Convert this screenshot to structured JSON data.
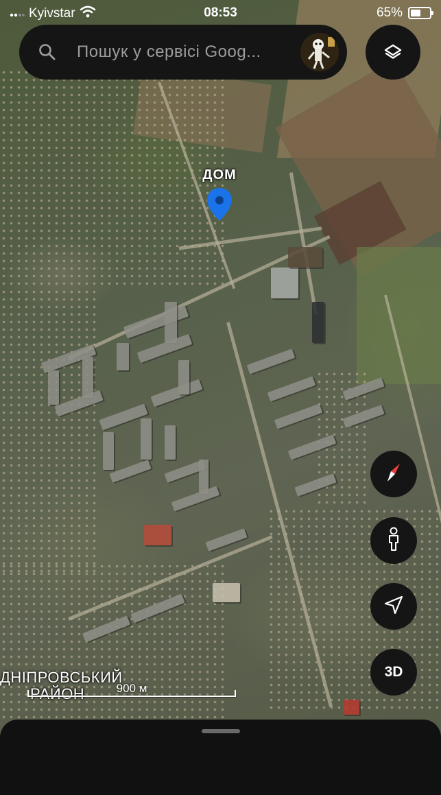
{
  "status_bar": {
    "carrier": "Kyivstar",
    "time": "08:53",
    "battery_percent": "65%",
    "battery_level": 0.65
  },
  "search": {
    "placeholder": "Пошук у сервісі Goog..."
  },
  "map": {
    "pin_label": "ДОМ",
    "district_line1": "ДНІПРОВСЬКИЙ",
    "district_line2": "РАЙОН",
    "scale_label": "900 м"
  },
  "controls": {
    "layers_icon": "layers-icon",
    "compass_icon": "compass-icon",
    "street_view_icon": "pegman-icon",
    "location_icon": "location-arrow-icon",
    "mode_3d_label": "3D"
  },
  "colors": {
    "pin": "#1a73e8",
    "button_bg": "#151515",
    "compass_red": "#e8413a"
  }
}
